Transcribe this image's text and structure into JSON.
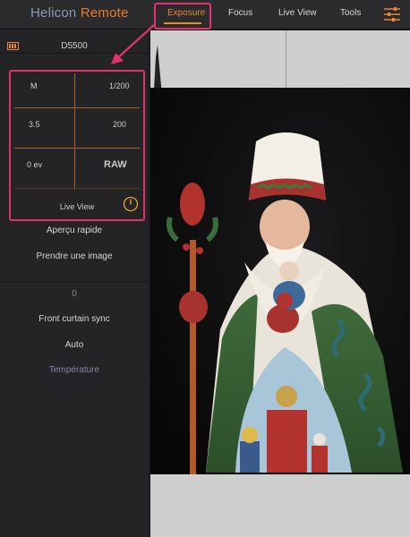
{
  "app": {
    "brand_part1": "Helicon",
    "brand_part2": "Remote"
  },
  "tabs": [
    {
      "label": "Exposure",
      "active": true
    },
    {
      "label": "Focus",
      "active": false
    },
    {
      "label": "Live View",
      "active": false
    },
    {
      "label": "Tools",
      "active": false
    }
  ],
  "camera": {
    "model": "D5500",
    "battery_icon": "battery-icon"
  },
  "exposure": {
    "mode": "M",
    "shutter": "1/200",
    "aperture": "3.5",
    "iso": "200",
    "ev": "0 ev",
    "format": "RAW",
    "live_view_label": "Live View",
    "power_icon": "power-icon"
  },
  "menu": {
    "quick_preview": "Aperçu rapide",
    "take_picture": "Prendre une image",
    "value": "0",
    "flash_mode": "Front curtain sync",
    "white_balance": "Auto",
    "temperature": "Température"
  },
  "colors": {
    "accent": "#e8892e",
    "highlight": "#e0336e",
    "brand_blue": "#8a9ab0"
  }
}
